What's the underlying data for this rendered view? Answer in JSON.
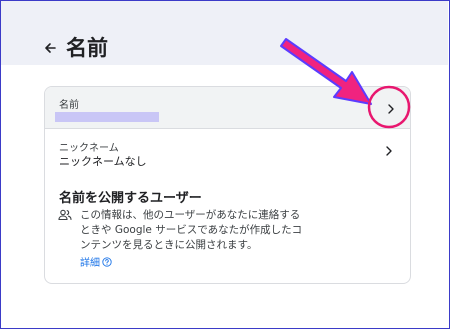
{
  "page": {
    "title": "名前"
  },
  "name_row": {
    "label": "名前"
  },
  "nickname_row": {
    "label": "ニックネーム",
    "value": "ニックネームなし"
  },
  "visibility": {
    "title": "名前を公開するユーザー",
    "description": "この情報は、他のユーザーがあなたに連絡するときや Google サービスであなたが作成したコンテンツを見るときに公開されます。",
    "details_link": "詳細"
  },
  "annotation": {
    "arrow_color": "#f0237f",
    "circle_color": "#e8176f",
    "arrow_outline": "#5b3cff"
  },
  "colors": {
    "header_bg": "#eef0f7",
    "link": "#1a73e8",
    "redaction": "#c9c6f6"
  }
}
